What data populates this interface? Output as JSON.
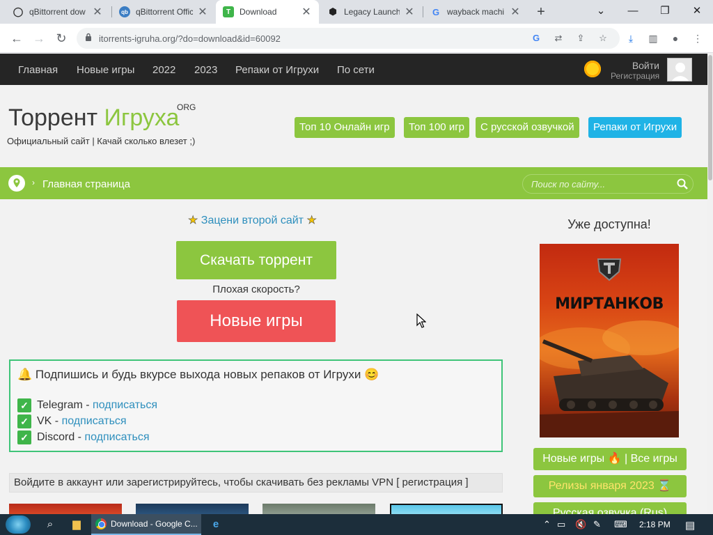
{
  "browser": {
    "tabs": [
      {
        "title": "qBittorrent dow",
        "icon": "search-icon",
        "active": false
      },
      {
        "title": "qBittorrent Offic",
        "icon": "qbittorrent-icon",
        "active": false
      },
      {
        "title": "Download",
        "icon": "site-icon",
        "active": true
      },
      {
        "title": "Legacy Launche",
        "icon": "legacy-icon",
        "active": false
      },
      {
        "title": "wayback machi",
        "icon": "google-icon",
        "active": false
      }
    ],
    "new_tab": "+",
    "url": "itorrents-igruha.org/?do=download&id=60092"
  },
  "site": {
    "nav": [
      "Главная",
      "Новые игры",
      "2022",
      "2023",
      "Репаки от Игрухи",
      "По сети"
    ],
    "login": "Войти",
    "register": "Регистрация",
    "logo_part1": "Торрент ",
    "logo_part2": "Игруха",
    "logo_org": "ORG",
    "slogan": "Официальный сайт | Качай сколько влезет ;)",
    "header_buttons": [
      "Топ 10 Онлайн игр",
      "Топ 100 игр",
      "С русской озвучкой",
      "Репаки от Игрухи"
    ],
    "breadcrumb": "Главная страница",
    "search_placeholder": "Поиск по сайту...",
    "rate_link": "Зацени второй сайт",
    "download_button": "Скачать торрент",
    "slow_speed": "Плохая скорость?",
    "new_games_button": "Новые игры",
    "subscribe_headline": "Подпишись и будь вкурсе выхода новых репаков от Игрухи",
    "subscribe_rows": [
      {
        "name": "Telegram - ",
        "link": "подписаться"
      },
      {
        "name": "VK - ",
        "link": "подписаться"
      },
      {
        "name": "Discord - ",
        "link": "подписаться"
      }
    ],
    "vpn_notice": "Войдите в аккаунт или зарегистрируйтесь, чтобы скачивать без рекламы VPN [ регистрация ]",
    "side_title": "Уже доступна!",
    "poster_title": "МИРТАНКОВ",
    "side_buttons": [
      "Новые игры 🔥 | Все игры",
      "Релизы января 2023 ⌛",
      "Русская озвучка (Rus)"
    ]
  },
  "taskbar": {
    "app_label": "Download - Google C...",
    "time": "2:18 PM"
  },
  "colors": {
    "green": "#8cc63f",
    "blue": "#1fb3e6",
    "red": "#ef5356",
    "link": "#2e8fbd",
    "nav_bg": "#252525"
  }
}
